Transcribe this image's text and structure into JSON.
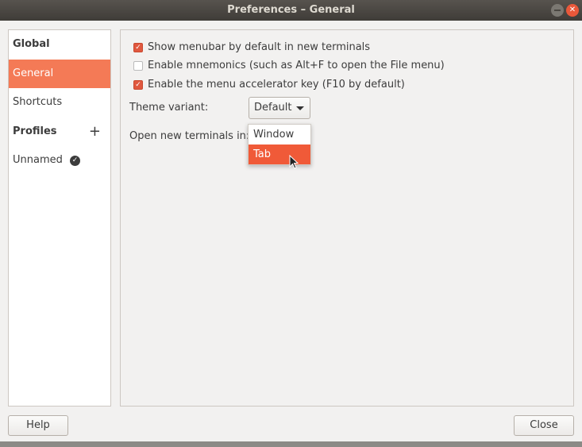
{
  "window": {
    "title": "Preferences – General",
    "minimize_icon": "minimize-icon",
    "close_icon": "close-icon"
  },
  "sidebar": {
    "items": [
      {
        "label": "Global",
        "type": "header"
      },
      {
        "label": "General",
        "selected": true
      },
      {
        "label": "Shortcuts"
      },
      {
        "label": "Profiles",
        "type": "header",
        "action": "+"
      },
      {
        "label": "Unnamed",
        "default_icon": "check-circle-icon"
      }
    ]
  },
  "general": {
    "checkboxes": [
      {
        "label": "Show menubar by default in new terminals",
        "checked": true
      },
      {
        "label": "Enable mnemonics (such as Alt+F to open the File menu)",
        "checked": false
      },
      {
        "label": "Enable the menu accelerator key (F10 by default)",
        "checked": true
      }
    ],
    "theme_label": "Theme variant:",
    "theme_value": "Default",
    "open_label": "Open new terminals in:",
    "open_options": [
      "Window",
      "Tab"
    ],
    "open_highlighted": "Tab"
  },
  "footer": {
    "help": "Help",
    "close": "Close"
  },
  "colors": {
    "accent": "#f47a56",
    "highlight": "#f05a38"
  }
}
